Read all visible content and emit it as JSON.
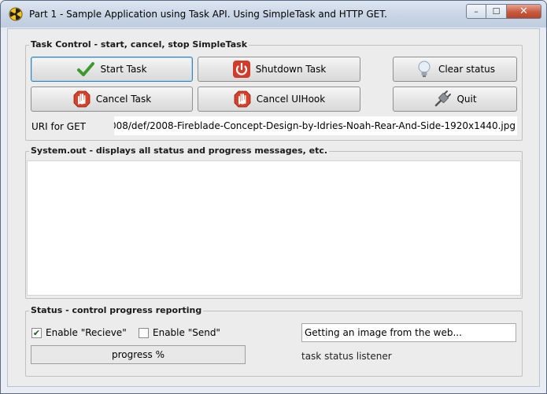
{
  "window": {
    "title": "Part 1 - Sample Application using Task API. Using SimpleTask and HTTP GET.",
    "icon": "radiation-icon",
    "controls": {
      "minimize": "–",
      "maximize": "☐",
      "close": "✕"
    }
  },
  "task_control": {
    "legend": "Task Control - start, cancel, stop SimpleTask",
    "buttons": {
      "start": {
        "label": "Start Task",
        "icon": "checkmark-icon"
      },
      "shutdown": {
        "label": "Shutdown Task",
        "icon": "power-icon"
      },
      "clear": {
        "label": "Clear status",
        "icon": "lightbulb-icon"
      },
      "cancel": {
        "label": "Cancel Task",
        "icon": "stop-hand-icon"
      },
      "cancel_uihook": {
        "label": "Cancel UIHook",
        "icon": "stop-hand-icon"
      },
      "quit": {
        "label": "Quit",
        "icon": "plug-icon"
      }
    },
    "uri_label": "URI for GET",
    "uri_value": "008/def/2008-Fireblade-Concept-Design-by-Idries-Noah-Rear-And-Side-1920x1440.jpg"
  },
  "system_out": {
    "legend": "System.out - displays all status and progress messages, etc.",
    "content": ""
  },
  "status": {
    "legend": "Status - control progress reporting",
    "enable_receive": {
      "label": "Enable \"Recieve\"",
      "checked": true
    },
    "enable_send": {
      "label": "Enable \"Send\"",
      "checked": false
    },
    "progress_label": "progress %",
    "status_text": "Getting an image from the web...",
    "listener_label": "task status listener"
  },
  "colors": {
    "check_green": "#3a9a2a",
    "stop_red": "#d8402a",
    "power_red": "#d23a2a"
  }
}
